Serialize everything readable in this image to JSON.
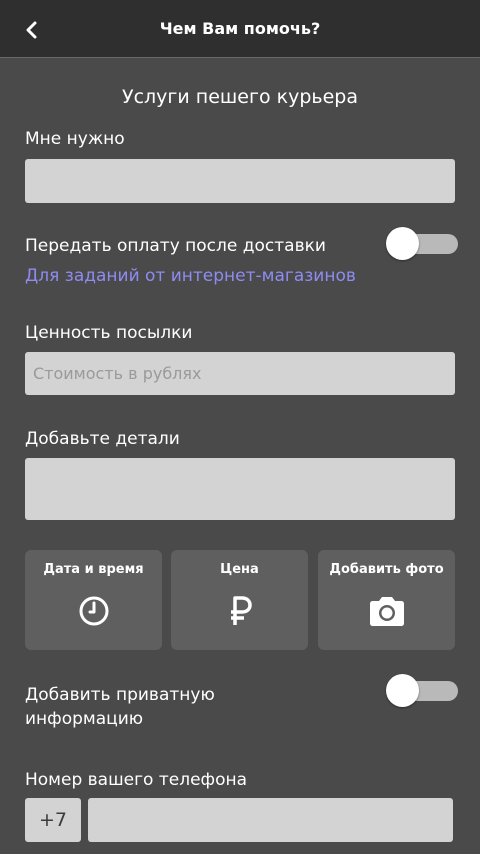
{
  "header": {
    "title": "Чем Вам помочь?",
    "back_icon": "chevron-left-icon"
  },
  "form": {
    "section_title": "Услуги пешего курьера",
    "need_label": "Мне нужно",
    "need_value": "",
    "transfer_payment_label": "Передать оплату после доставки",
    "transfer_payment_on": false,
    "shops_link": "Для заданий от интернет-магазинов",
    "value_label": "Ценность посылки",
    "value_placeholder": "Стоимость в рублях",
    "details_label": "Добавьте детали",
    "details_value": "",
    "private_info_label_line1": "Добавить приватную",
    "private_info_label_line2": "информацию",
    "private_info_on": false,
    "phone_label": "Номер вашего телефона",
    "phone_prefix": "+7",
    "phone_value": ""
  },
  "tiles": [
    {
      "label": "Дата и время",
      "icon": "clock-icon"
    },
    {
      "label": "Цена",
      "icon": "ruble-icon"
    },
    {
      "label": "Добавить фото",
      "icon": "camera-icon"
    }
  ],
  "colors": {
    "background": "#4a4a4a",
    "header": "#2f2f2f",
    "field": "#d3d3d3",
    "tile": "#5f5f5f",
    "link": "#8e8cf0"
  }
}
